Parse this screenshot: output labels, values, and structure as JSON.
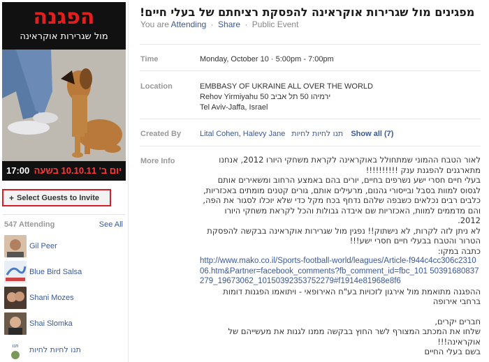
{
  "event": {
    "title": "מפגינים מול שגרירות אוקראינה להפסקת רציחתם של בעלי חיים!",
    "status_prefix": "You are",
    "attending_link": "Attending",
    "share_link": "Share",
    "event_type": "Public Event"
  },
  "poster": {
    "title": "הפגנה",
    "subtitle": "מול שגרירות אוקראינה",
    "time": "17:00",
    "date_text": "יום ב' 10.10.11 בשעה"
  },
  "invite": {
    "label": "Select Guests to Invite",
    "icon": "plus-icon"
  },
  "attendees": {
    "count_label": "547 Attending",
    "see_all": "See All",
    "list": [
      {
        "name": "Gil Peer"
      },
      {
        "name": "Blue Bird Salsa"
      },
      {
        "name": "Shani Mozes"
      },
      {
        "name": "Shai Slomka"
      },
      {
        "name": "תנו לחיות לחיות"
      }
    ]
  },
  "details": {
    "time_label": "Time",
    "time_value": "Monday, October 10 · 5:00pm - 7:00pm",
    "location_label": "Location",
    "location_line1": "EMBBASY OF UKRAINE ALL OVER THE WORLD",
    "location_line2": "Rehov Yirmiyahu 50 ירמיהו 50 תל אביב",
    "location_line3": "Tel Aviv-Jaffa, Israel",
    "created_label": "Created By",
    "creator1": "Lital Cohen",
    "creator2": "Halevy Jane",
    "creator3": "תנו לחיות לחיות",
    "show_all": "Show all (7)",
    "info_label": "More Info",
    "info": {
      "p1": "לאור הטבח ההמוני שמתחולל באוקראינה לקראת משחקי היורו 2012, אנחנו מתארגנים להפגנת ענק !!!!!!!!!!",
      "p2": "בעלי חיים חסרי ישע נשרפים בחיים, יורים בהם באמצע הרחוב ומשאירים אותם לגסוס למוות בסבל ובייסורי גהנום, מרעילים אותם, גורים קטנים מומתים באכזריות, כלבים רבים נכלאים כשבפה שלהם נדחף בכח מקל כדי שלא יוכלו לסגור את הפה, והם מדממים למוות, האכזריות שם איבדה גבולות והכל לקראת משחקי היורו 2012.",
      "p3": "לא ניתן לזה לקרות, לא נישתוק!! נפגין מול שגרירות אוקראינה בבקשה להפסקת הטרור והטבח בבעלי חיים חסרי ישע!!!",
      "p4": "כתבה במקו:",
      "url": "http://www.mako.co.il/Sports-football-world/leagues/Article-f944c4cc306c231006.htm&Partner=facebook_comments?fb_comment_id=fbc_101 50391680837279_19673062_10150392353752279#f1914e81968e8f6",
      "p5": "ההפגנה מתואמת מול אירגון לזכויות בע\"ח האירופאי - ויתואמו הפגנות דומות ברחבי אירופה",
      "p6": "חברים יקרים,",
      "p7": "שלחו את המכתב המצורף לשר החוץ בבקשה ממנו לגנות את מעשייהם של אוקראינה!!!",
      "p8": "בשם בעלי החיים"
    }
  }
}
